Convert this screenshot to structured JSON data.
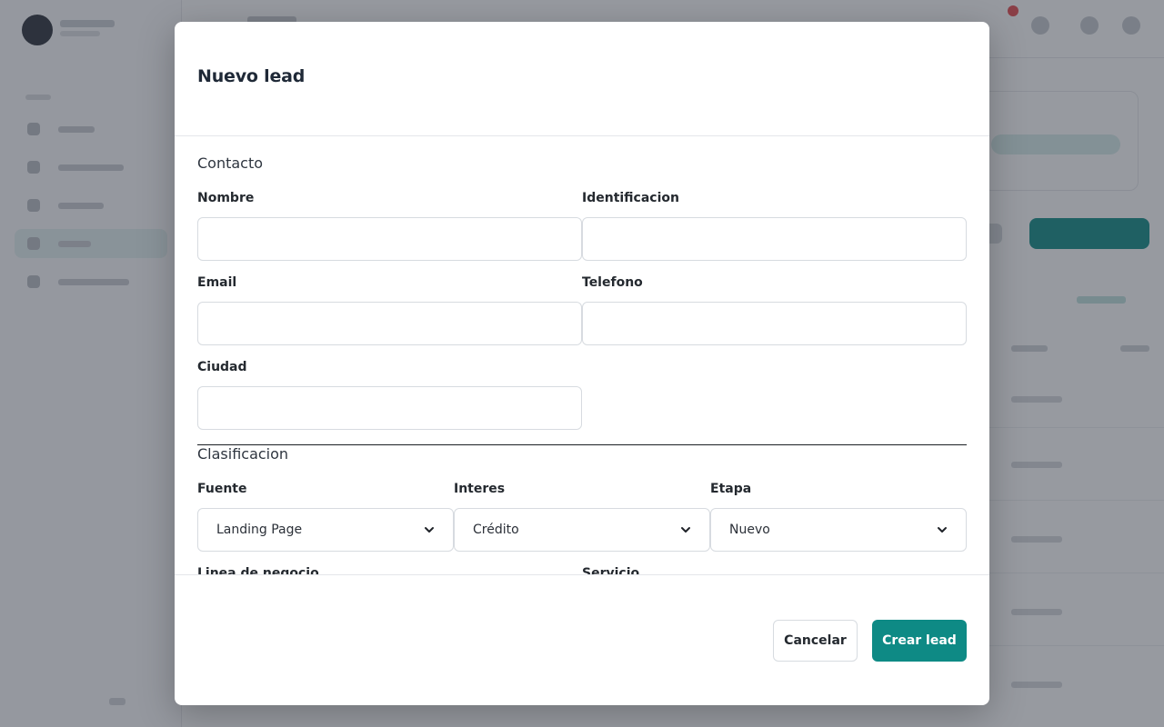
{
  "modal": {
    "title": "Nuevo lead"
  },
  "contacto": {
    "section_title": "Contacto",
    "nombre_label": "Nombre",
    "nombre_value": "",
    "identificacion_label": "Identificacion",
    "identificacion_value": "",
    "email_label": "Email",
    "email_value": "",
    "telefono_label": "Telefono",
    "telefono_value": "",
    "ciudad_label": "Ciudad",
    "ciudad_value": ""
  },
  "clasificacion": {
    "section_title": "Clasificacion",
    "fuente_label": "Fuente",
    "fuente_value": "Landing Page",
    "interes_label": "Interes",
    "interes_value": "Crédito",
    "etapa_label": "Etapa",
    "etapa_value": "Nuevo",
    "linea_label": "Linea de negocio",
    "servicio_label": "Servicio"
  },
  "footer": {
    "cancel_label": "Cancelar",
    "submit_label": "Crear lead"
  },
  "colors": {
    "primary": "#0e8a85",
    "overlay": "rgba(47,53,66,0.5)"
  }
}
